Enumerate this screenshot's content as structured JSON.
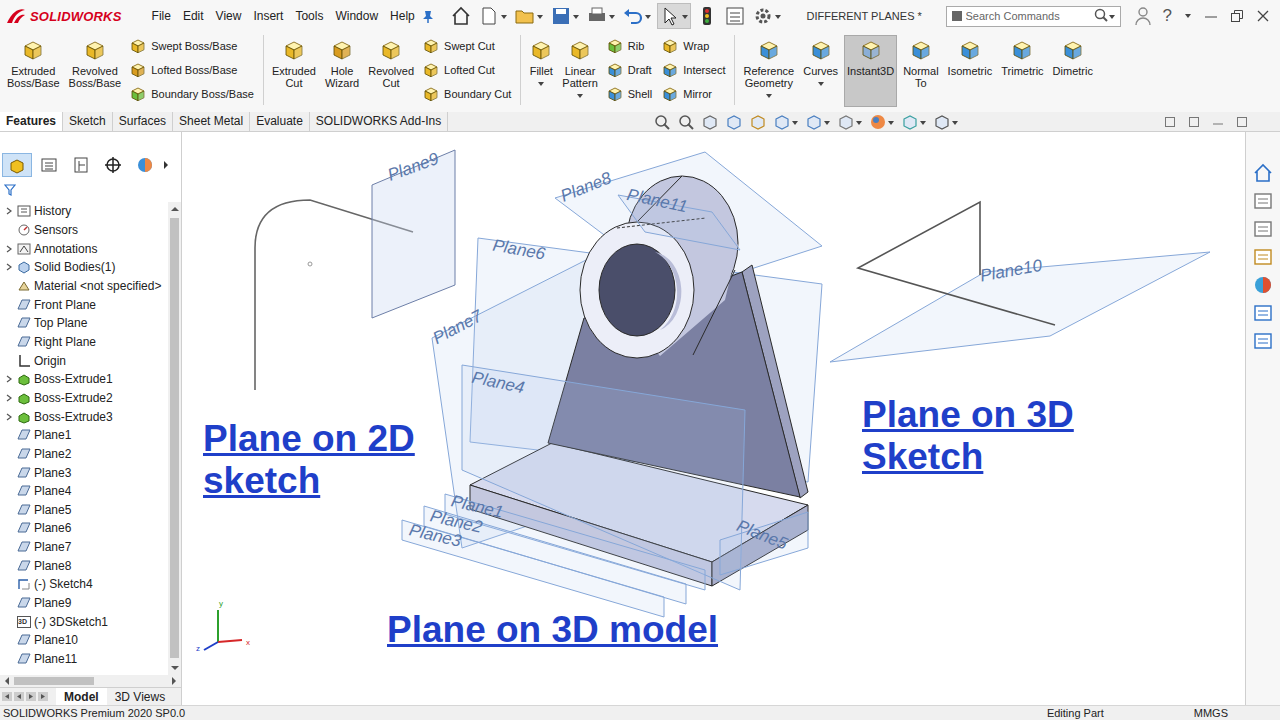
{
  "app": {
    "logo": "SOLIDWORKS"
  },
  "menu": [
    "File",
    "Edit",
    "View",
    "Insert",
    "Tools",
    "Window",
    "Help"
  ],
  "window": {
    "title": "DIFFERENT PLANES *"
  },
  "search": {
    "placeholder": "Search Commands"
  },
  "help": "?",
  "ribbon": [
    {
      "kind": "large",
      "label": "Extruded\nBoss/Base",
      "selected": false,
      "dropdown": false
    },
    {
      "kind": "large",
      "label": "Revolved\nBoss/Base",
      "selected": false,
      "dropdown": false
    },
    {
      "kind": "stack",
      "items": [
        "Swept Boss/Base",
        "Lofted Boss/Base",
        "Boundary Boss/Base"
      ]
    },
    {
      "kind": "separator"
    },
    {
      "kind": "large",
      "label": "Extruded\nCut",
      "selected": false,
      "dropdown": false
    },
    {
      "kind": "large",
      "label": "Hole\nWizard",
      "selected": false,
      "dropdown": false
    },
    {
      "kind": "large",
      "label": "Revolved\nCut",
      "selected": false,
      "dropdown": false
    },
    {
      "kind": "stack",
      "items": [
        "Swept Cut",
        "Lofted Cut",
        "Boundary Cut"
      ]
    },
    {
      "kind": "separator"
    },
    {
      "kind": "large",
      "label": "Fillet",
      "selected": false,
      "dropdown": true
    },
    {
      "kind": "large",
      "label": "Linear\nPattern",
      "selected": false,
      "dropdown": true
    },
    {
      "kind": "stack",
      "items": [
        "Rib",
        "Draft",
        "Shell"
      ]
    },
    {
      "kind": "stack",
      "items": [
        "Wrap",
        "Intersect",
        "Mirror"
      ]
    },
    {
      "kind": "separator"
    },
    {
      "kind": "large",
      "label": "Reference\nGeometry",
      "selected": false,
      "dropdown": true
    },
    {
      "kind": "large",
      "label": "Curves",
      "selected": false,
      "dropdown": true
    },
    {
      "kind": "large",
      "label": "Instant3D",
      "selected": true,
      "dropdown": false
    },
    {
      "kind": "large",
      "label": "Normal\nTo",
      "selected": false,
      "dropdown": false
    },
    {
      "kind": "large",
      "label": "Isometric",
      "selected": false,
      "dropdown": false
    },
    {
      "kind": "large",
      "label": "Trimetric",
      "selected": false,
      "dropdown": false
    },
    {
      "kind": "large",
      "label": "Dimetric",
      "selected": false,
      "dropdown": false
    }
  ],
  "command_tabs": [
    {
      "label": "Features",
      "selected": true
    },
    {
      "label": "Sketch",
      "selected": false
    },
    {
      "label": "Surfaces",
      "selected": false
    },
    {
      "label": "Sheet Metal",
      "selected": false
    },
    {
      "label": "Evaluate",
      "selected": false
    },
    {
      "label": "SOLIDWORKS Add-Ins",
      "selected": false
    }
  ],
  "panel_tabs": [
    {
      "selected": true
    },
    {
      "selected": false
    },
    {
      "selected": false
    },
    {
      "selected": false
    },
    {
      "selected": false
    }
  ],
  "tree": [
    {
      "label": "History",
      "kind": "history",
      "expandable": true
    },
    {
      "label": "Sensors",
      "kind": "sensor",
      "expandable": false
    },
    {
      "label": "Annotations",
      "kind": "annotation",
      "expandable": true
    },
    {
      "label": "Solid Bodies(1)",
      "kind": "body",
      "expandable": true
    },
    {
      "label": "Material <not specified>",
      "kind": "material",
      "expandable": false
    },
    {
      "label": "Front Plane",
      "kind": "plane",
      "expandable": false
    },
    {
      "label": "Top Plane",
      "kind": "plane",
      "expandable": false
    },
    {
      "label": "Right Plane",
      "kind": "plane",
      "expandable": false
    },
    {
      "label": "Origin",
      "kind": "origin",
      "expandable": false
    },
    {
      "label": "Boss-Extrude1",
      "kind": "feature",
      "expandable": true
    },
    {
      "label": "Boss-Extrude2",
      "kind": "feature",
      "expandable": true
    },
    {
      "label": "Boss-Extrude3",
      "kind": "feature",
      "expandable": true
    },
    {
      "label": "Plane1",
      "kind": "plane",
      "expandable": false
    },
    {
      "label": "Plane2",
      "kind": "plane",
      "expandable": false
    },
    {
      "label": "Plane3",
      "kind": "plane",
      "expandable": false
    },
    {
      "label": "Plane4",
      "kind": "plane",
      "expandable": false
    },
    {
      "label": "Plane5",
      "kind": "plane",
      "expandable": false
    },
    {
      "label": "Plane6",
      "kind": "plane",
      "expandable": false
    },
    {
      "label": "Plane7",
      "kind": "plane",
      "expandable": false
    },
    {
      "label": "Plane8",
      "kind": "plane",
      "expandable": false
    },
    {
      "label": "(-) Sketch4",
      "kind": "sketch",
      "expandable": false
    },
    {
      "label": "Plane9",
      "kind": "plane",
      "expandable": false
    },
    {
      "label": "(-) 3DSketch1",
      "kind": "sketch3d",
      "expandable": false,
      "badge": "3D"
    },
    {
      "label": "Plane10",
      "kind": "plane",
      "expandable": false
    },
    {
      "label": "Plane11",
      "kind": "plane",
      "expandable": false
    }
  ],
  "bottom_tabs": [
    {
      "label": "Model",
      "selected": true
    },
    {
      "label": "3D Views",
      "selected": false
    }
  ],
  "viewport": {
    "plane_labels": [
      "Plane9",
      "Plane8",
      "Plane11",
      "Plane6",
      "Plane7",
      "Plane4",
      "Plane1",
      "Plane2",
      "Plane3",
      "Plane10",
      "Plane5"
    ],
    "captions": [
      "Plane on 2D\nsketch",
      "Plane on 3D\nSketch",
      "Plane on 3D model"
    ],
    "triad": [
      "y",
      "x",
      "z"
    ]
  },
  "status_bar": {
    "left": "SOLIDWORKS Premium 2020 SP0.0",
    "mode": "Editing Part",
    "units": "MMGS"
  }
}
